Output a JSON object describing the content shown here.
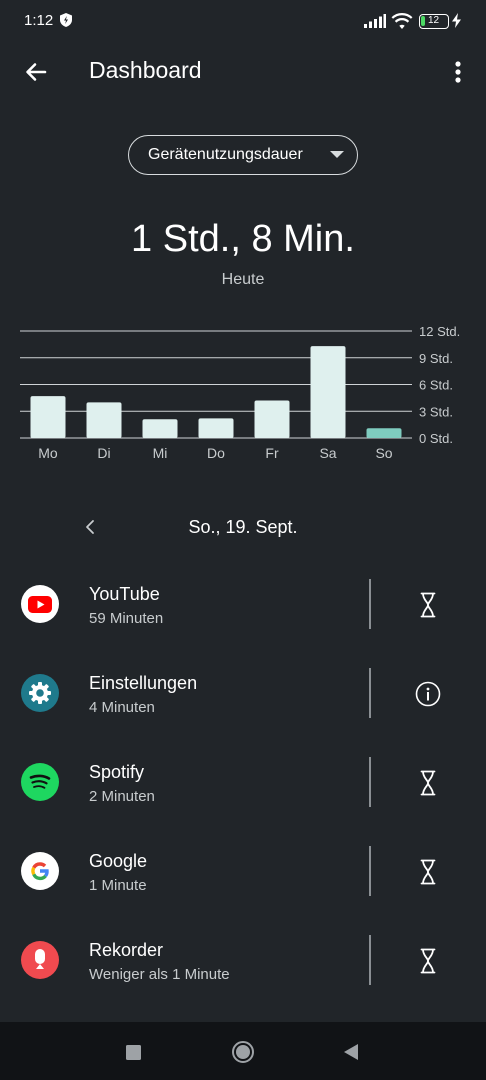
{
  "status_bar": {
    "time": "1:12",
    "battery": "12"
  },
  "header": {
    "title": "Dashboard"
  },
  "selector": {
    "value": "Gerätenutzungsdauer"
  },
  "summary": {
    "total": "1 Std., 8 Min.",
    "period": "Heute"
  },
  "chart_data": {
    "type": "bar",
    "categories": [
      "Mo",
      "Di",
      "Mi",
      "Do",
      "Fr",
      "Sa",
      "So"
    ],
    "values": [
      4.7,
      4.0,
      2.1,
      2.2,
      4.2,
      10.3,
      1.1
    ],
    "highlight_index": 6,
    "y_ticks": [
      "12 Std.",
      "9 Std.",
      "6 Std.",
      "3 Std.",
      "0 Std."
    ],
    "ylim": [
      0,
      12
    ],
    "bar_color": "#dff0ee",
    "highlight_color": "#7fccbf",
    "gridline_color": "#cfd3d6"
  },
  "date_nav": {
    "label": "So., 19. Sept."
  },
  "apps": [
    {
      "name": "YouTube",
      "time": "59 Minuten",
      "icon": "youtube-icon",
      "action": "timer-icon"
    },
    {
      "name": "Einstellungen",
      "time": "4 Minuten",
      "icon": "settings-icon",
      "action": "info-icon"
    },
    {
      "name": "Spotify",
      "time": "2 Minuten",
      "icon": "spotify-icon",
      "action": "timer-icon"
    },
    {
      "name": "Google",
      "time": "1 Minute",
      "icon": "google-icon",
      "action": "timer-icon"
    },
    {
      "name": "Rekorder",
      "time": "Weniger als 1 Minute",
      "icon": "recorder-icon",
      "action": "timer-icon"
    }
  ],
  "colors": {
    "background": "#212529",
    "youtube": "#ff0000",
    "settings": "#1f7a8c",
    "spotify": "#1ed760",
    "recorder": "#f04a4f"
  }
}
